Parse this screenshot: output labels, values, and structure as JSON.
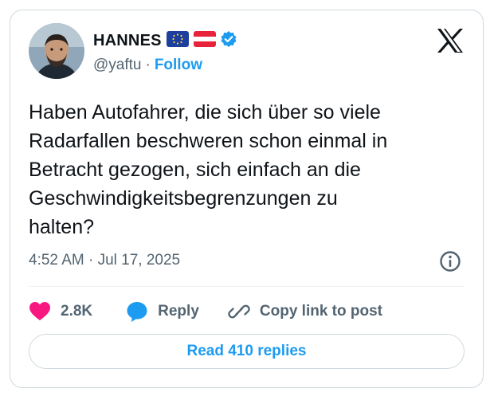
{
  "author": {
    "display_name": "HANNES",
    "handle": "@yaftu",
    "separator": "·",
    "follow_label": "Follow",
    "flags": [
      "eu-flag",
      "austria-flag"
    ],
    "verified": true
  },
  "tweet": {
    "text": "Haben Autofahrer, die sich über so viele\nRadarfallen beschweren schon einmal in\nBetracht gezogen, sich einfach an die\nGeschwindigkeitsbegrenzungen zu\nhalten?",
    "timestamp": "4:52 AM · Jul 17, 2025"
  },
  "actions": {
    "likes": "2.8K",
    "reply_label": "Reply",
    "copy_link_label": "Copy link to post"
  },
  "read_replies_label": "Read 410 replies",
  "colors": {
    "accent": "#1d9bf0",
    "like": "#f91880",
    "text": "#0f1419",
    "secondary": "#536471",
    "border": "#cfd9de"
  }
}
